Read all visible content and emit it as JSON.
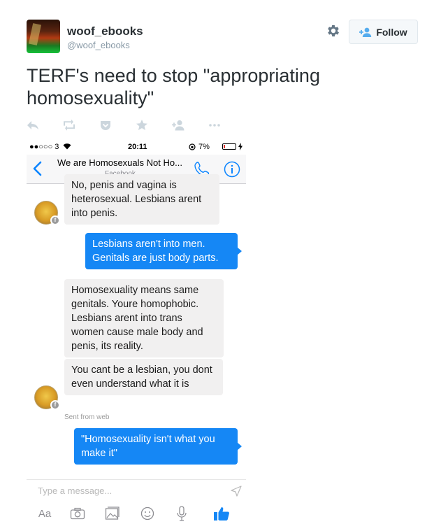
{
  "user": {
    "display_name": "woof_ebooks",
    "handle": "@woof_ebooks"
  },
  "follow_button": {
    "label": "Follow"
  },
  "tweet": {
    "text": "TERF's need to stop \"appropriating homosexuality\""
  },
  "actions": [
    "reply-icon",
    "retweet-icon",
    "pocket-icon",
    "favorite-icon",
    "add-user-icon",
    "more-icon"
  ],
  "screenshot": {
    "status_bar": {
      "carrier": "●●○○○ 3",
      "time": "20:11",
      "battery": "7%"
    },
    "nav": {
      "title": "We are Homosexuals Not Ho...",
      "subtitle": "Facebook"
    },
    "messages": {
      "m0": "No, penis and vagina is heterosexual. Lesbians arent into penis.",
      "m1": "Lesbians aren't into men. Genitals are just body parts.",
      "m2": "Homosexuality means same genitals. Youre homophobic. Lesbians arent into trans women cause male body and penis, its reality.",
      "m3": "You cant be a lesbian, you dont even understand what it is",
      "m4": "\"Homosexuality isn't what you make it\""
    },
    "sent_note": "Sent from web",
    "composer": {
      "placeholder": "Type a message..."
    },
    "toolbar": {
      "text_label": "Aa"
    }
  },
  "colors": {
    "outgoing_bubble": "#1587f5",
    "incoming_bubble": "#f1f0f0",
    "messenger_blue": "#0a84ff"
  }
}
